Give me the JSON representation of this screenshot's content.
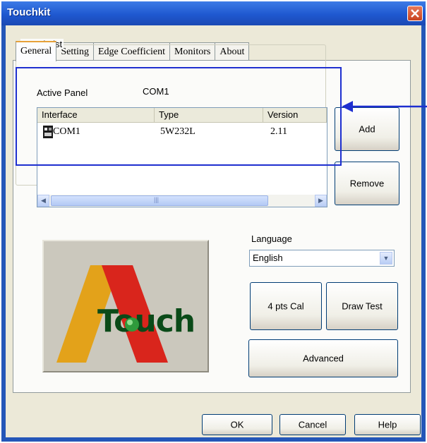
{
  "window": {
    "title": "Touchkit"
  },
  "tabs": [
    {
      "label": "General"
    },
    {
      "label": "Setting"
    },
    {
      "label": "Edge Coefficient"
    },
    {
      "label": "Monitors"
    },
    {
      "label": "About"
    }
  ],
  "panel_list": {
    "group_label": "Panel List",
    "active_panel_label": "Active Panel",
    "active_panel_value": "COM1",
    "columns": [
      "Interface",
      "Type",
      "Version"
    ],
    "rows": [
      {
        "interface": "COM1",
        "type": "5W232L",
        "version": "2.11"
      }
    ],
    "scroll_thumb_grip": "|||"
  },
  "buttons": {
    "add": "Add",
    "remove": "Remove",
    "cal": "4 pts Cal",
    "draw_test": "Draw Test",
    "advanced": "Advanced",
    "ok": "OK",
    "cancel": "Cancel",
    "help": "Help"
  },
  "language": {
    "label": "Language",
    "selected": "English"
  },
  "logo": {
    "text": "Touch"
  },
  "colors": {
    "title_bar": "#2456b8",
    "highlight_box": "#1e2fd0",
    "logo_yellow": "#e3a21a",
    "logo_red": "#d9251c",
    "logo_green": "#0a4a18"
  }
}
